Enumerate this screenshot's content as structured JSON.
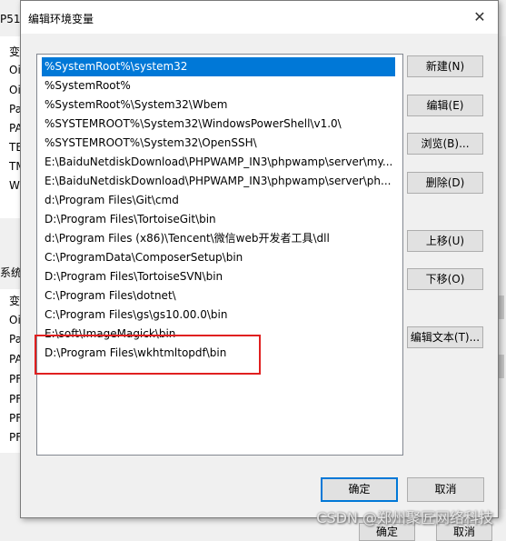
{
  "background": {
    "top_left_label": "P51",
    "upper_items": [
      "变",
      "Oi",
      "Oi",
      "Pa",
      "PA",
      "TE",
      "TM",
      "W"
    ],
    "section_label": "系统",
    "lower_items": [
      "变",
      "Oi",
      "Pa",
      "PA",
      "PF",
      "PF",
      "PF",
      "PF"
    ],
    "bottom_ok": "确定",
    "bottom_cancel": "取消"
  },
  "dialog": {
    "title": "编辑环境变量",
    "close_symbol": "✕"
  },
  "paths": [
    "%SystemRoot%\\system32",
    "%SystemRoot%",
    "%SystemRoot%\\System32\\Wbem",
    "%SYSTEMROOT%\\System32\\WindowsPowerShell\\v1.0\\",
    "%SYSTEMROOT%\\System32\\OpenSSH\\",
    "E:\\BaiduNetdiskDownload\\PHPWAMP_IN3\\phpwamp\\server\\my...",
    "E:\\BaiduNetdiskDownload\\PHPWAMP_IN3\\phpwamp\\server\\ph...",
    "d:\\Program Files\\Git\\cmd",
    "D:\\Program Files\\TortoiseGit\\bin",
    "d:\\Program Files (x86)\\Tencent\\微信web开发者工具\\dll",
    "C:\\ProgramData\\ComposerSetup\\bin",
    "D:\\Program Files\\TortoiseSVN\\bin",
    "C:\\Program Files\\dotnet\\",
    "C:\\Program Files\\gs\\gs10.00.0\\bin",
    "E:\\soft\\ImageMagick\\bin",
    "D:\\Program Files\\wkhtmltopdf\\bin"
  ],
  "selected_index": 0,
  "buttons": {
    "new": "新建(N)",
    "edit": "编辑(E)",
    "browse": "浏览(B)...",
    "delete": "删除(D)",
    "move_up": "上移(U)",
    "move_down": "下移(O)",
    "edit_text": "编辑文本(T)...",
    "ok": "确定",
    "cancel": "取消"
  },
  "watermark": "CSDN @郑州聚匠网络科技",
  "colors": {
    "selection": "#0078d7",
    "highlight_box": "#e02020"
  }
}
